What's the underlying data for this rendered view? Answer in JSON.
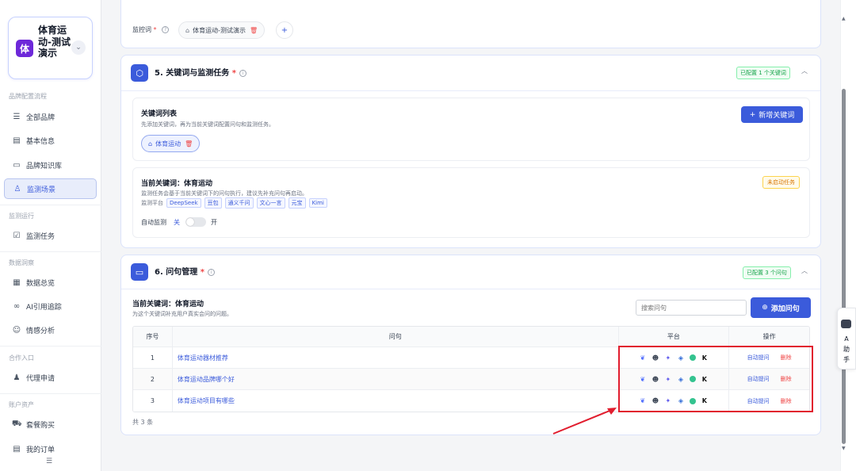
{
  "sidebar": {
    "brand": {
      "logo_char": "体",
      "name": "体育运动-测试演示"
    },
    "sections": [
      {
        "title": "品牌配置流程"
      },
      {
        "title": "监测运行"
      },
      {
        "title": "数据洞察"
      },
      {
        "title": "合作入口"
      },
      {
        "title": "账户资产"
      }
    ],
    "items": [
      {
        "label": "全部品牌",
        "icon": "list-icon"
      },
      {
        "label": "基本信息",
        "icon": "document-icon"
      },
      {
        "label": "品牌知识库",
        "icon": "folder-icon"
      },
      {
        "label": "监测场景",
        "icon": "users-icon",
        "active": true
      },
      {
        "label": "监测任务",
        "icon": "clipboard-icon"
      },
      {
        "label": "数据总览",
        "icon": "dashboard-icon"
      },
      {
        "label": "AI引用追踪",
        "icon": "link-icon"
      },
      {
        "label": "情感分析",
        "icon": "smile-icon"
      },
      {
        "label": "代理申请",
        "icon": "agent-icon"
      },
      {
        "label": "套餐购买",
        "icon": "cart-icon"
      },
      {
        "label": "我的订单",
        "icon": "order-icon"
      }
    ]
  },
  "monitor_words": {
    "label": "监控词",
    "tag": "体育运动-测试演示"
  },
  "section5": {
    "title": "5. 关键词与监测任务",
    "status": "已配置 1 个关键词",
    "keyword_list": {
      "title": "关键词列表",
      "hint": "先添加关键词，再为当前关键词配置问句和监测任务。",
      "add_button": "新增关键词",
      "keywords": [
        "体育运动"
      ]
    },
    "current": {
      "title": "当前关键词：体育运动",
      "status": "未启动任务",
      "hint": "监测任务会基于当前关键词下的问句执行，建议先补充问句再启动。",
      "platform_label": "监测平台",
      "platforms": [
        "DeepSeek",
        "豆包",
        "通义千问",
        "文心一言",
        "元宝",
        "Kimi"
      ],
      "auto_label": "自动监测",
      "off_label": "关",
      "on_label": "开"
    }
  },
  "section6": {
    "title": "6. 问句管理",
    "status": "已配置 3 个问句",
    "current_keyword": "当前关键词：体育运动",
    "hint": "为这个关键词补充用户真实会问的问题。",
    "search_placeholder": "搜索问句",
    "add_button": "添加问句",
    "table": {
      "headers": {
        "no": "序号",
        "question": "问句",
        "platform": "平台",
        "ops": "操作"
      },
      "rows": [
        {
          "no": "1",
          "question": "体育运动器材推荐",
          "ask": "自动提问",
          "del": "删除"
        },
        {
          "no": "2",
          "question": "体育运动品牌哪个好",
          "ask": "自动提问",
          "del": "删除"
        },
        {
          "no": "3",
          "question": "体育运动项目有哪些",
          "ask": "自动提问",
          "del": "删除"
        }
      ]
    },
    "total": "共 3 条"
  },
  "float_helper": {
    "text": "A助手"
  },
  "colors": {
    "primary": "#3b5bdb",
    "danger": "#ef4444",
    "success": "#16a34a",
    "warning": "#d97706",
    "annotation": "#e11d2e"
  }
}
